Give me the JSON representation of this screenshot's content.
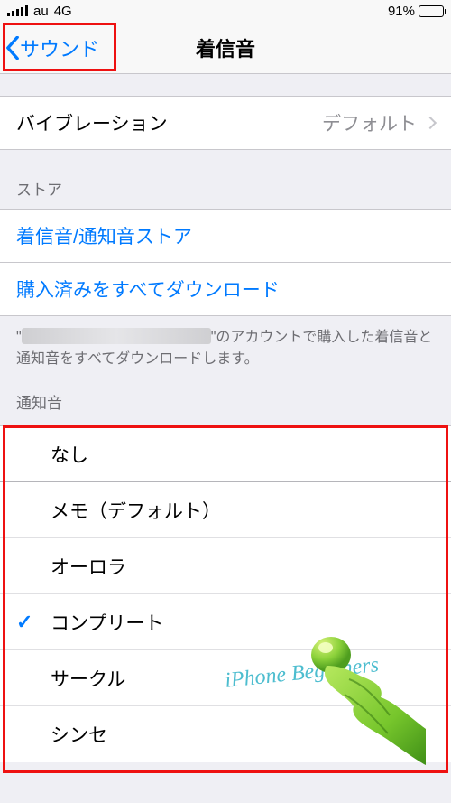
{
  "statusbar": {
    "carrier": "au",
    "network": "4G",
    "battery_pct": "91%"
  },
  "nav": {
    "back_label": "サウンド",
    "title": "着信音"
  },
  "vibration": {
    "label": "バイブレーション",
    "value": "デフォルト"
  },
  "store": {
    "header": "ストア",
    "tone_store": "着信音/通知音ストア",
    "download_all": "購入済みをすべてダウンロード",
    "footer_prefix": "\"",
    "footer_suffix": "\"のアカウントで購入した着信音と通知音をすべてダウンロードします。"
  },
  "sounds": {
    "header": "通知音",
    "items": [
      "なし",
      "メモ（デフォルト）",
      "オーロラ",
      "コンプリート",
      "サークル",
      "シンセ"
    ],
    "selected_index": 3
  },
  "watermark": "iPhone Beginners"
}
